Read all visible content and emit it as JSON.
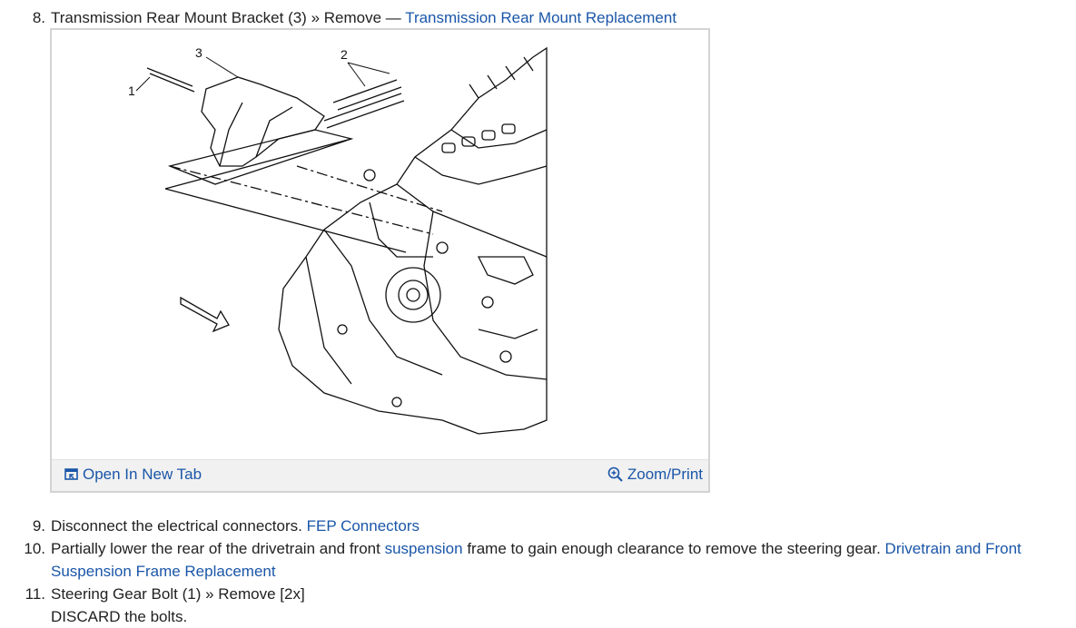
{
  "steps": [
    {
      "number": "8.",
      "text": "Transmission Rear Mount Bracket (3) » Remove — ",
      "link": "Transmission Rear Mount Replacement"
    },
    {
      "number": "9.",
      "text": "Disconnect the electrical connectors. ",
      "link": "FEP Connectors"
    },
    {
      "number": "10.",
      "text_a": "Partially lower the rear of the drivetrain and front ",
      "link_a": "suspension",
      "text_b": " frame to gain enough clearance to remove the steering gear. ",
      "link_b": "Drivetrain and Front Suspension Frame Replacement"
    },
    {
      "number": "11.",
      "text": "Steering Gear Bolt (1) » Remove [2x]",
      "note": "DISCARD the bolts."
    }
  ],
  "figure": {
    "callouts": [
      "1",
      "2",
      "3"
    ],
    "open_tab_label": "Open In New Tab",
    "zoom_label": "Zoom/Print",
    "icons": {
      "open_tab": "open-new-tab-icon",
      "zoom": "magnifier-plus-icon"
    },
    "colors": {
      "link": "#1a56a8",
      "toolbar_bg": "#f1f1f1",
      "border": "#d3d3d3"
    }
  }
}
